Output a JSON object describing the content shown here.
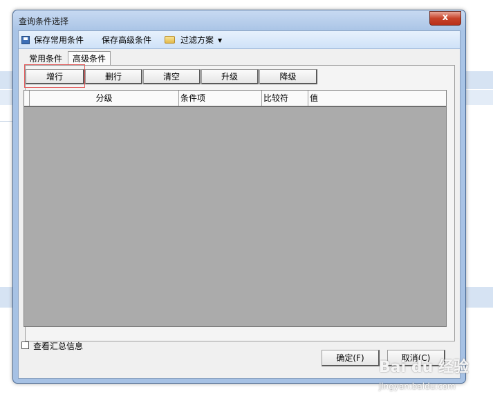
{
  "window": {
    "title": "查询条件选择",
    "close_glyph": "x"
  },
  "toolbar": {
    "save_common": "保存常用条件",
    "save_advanced": "保存高级条件",
    "filter_scheme": "过滤方案"
  },
  "tabs": [
    {
      "label": "常用条件",
      "active": false
    },
    {
      "label": "高级条件",
      "active": true
    }
  ],
  "actions": {
    "add_row": "增行",
    "delete_row": "删行",
    "clear": "清空",
    "upgrade": "升级",
    "downgrade": "降级"
  },
  "grid": {
    "columns": [
      "分级",
      "条件项",
      "比较符",
      "值"
    ]
  },
  "footer": {
    "summary_checkbox": "查看汇总信息",
    "ok": "确定(F)",
    "cancel": "取消(C)"
  },
  "watermark": {
    "logo": "Bai du 经验",
    "url": "jingyan.baidu.com"
  },
  "colors": {
    "title_gradient": "#a9c4e6",
    "toolbar": "#cfe2f8",
    "grid_bg": "#ababab",
    "highlight": "#e35a5a",
    "close": "#c7432a"
  }
}
